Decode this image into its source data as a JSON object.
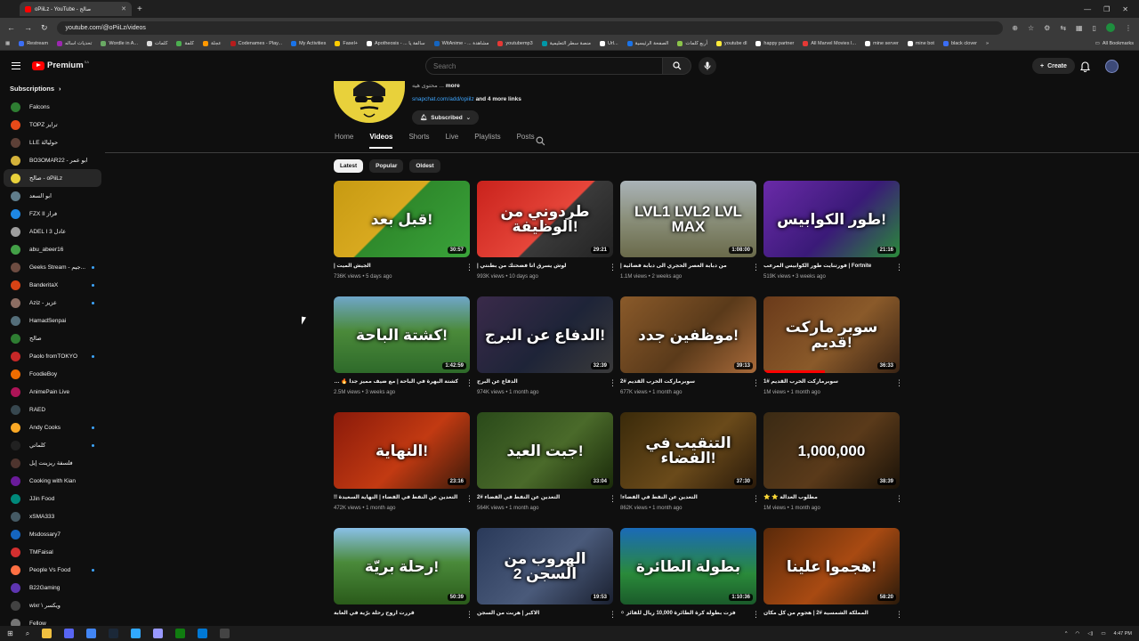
{
  "browser": {
    "tab_title": "oPiiLz - YouTube - صالح",
    "url": "youtube.com/@oPiiLz/videos",
    "bookmarks": [
      {
        "label": "Restream",
        "color": "#3b6ef5"
      },
      {
        "label": "تحديات اساله",
        "color": "#9c27b0"
      },
      {
        "label": "Wordle in A...",
        "color": "#6aaa64"
      },
      {
        "label": "كلمات",
        "color": "#dddddd"
      },
      {
        "label": "كلمة",
        "color": "#4caf50"
      },
      {
        "label": "عجلة",
        "color": "#ff9800"
      },
      {
        "label": "Codenames - Play...",
        "color": "#b71c1c"
      },
      {
        "label": "My Activities",
        "color": "#1a73e8"
      },
      {
        "label": "Fasel+",
        "color": "#ffcc00"
      },
      {
        "label": "Apotheosis - ... سالفة يا",
        "color": "#ffffff"
      },
      {
        "label": "WitAnime - ... مشاهدة",
        "color": "#1565c0"
      },
      {
        "label": "youtubemp3",
        "color": "#e53935"
      },
      {
        "label": "منصة سطر التعليمية",
        "color": "#0097a7"
      },
      {
        "label": "Url...",
        "color": "#ffffff"
      },
      {
        "label": "الصفحة الرئيسية",
        "color": "#1a73e8"
      },
      {
        "label": "أربع كلمات",
        "color": "#8bc34a"
      },
      {
        "label": "youtube dl",
        "color": "#ffeb3b"
      },
      {
        "label": "happy partner",
        "color": "#ffffff"
      },
      {
        "label": "All Marvel Movies I...",
        "color": "#e53935"
      },
      {
        "label": "mine server",
        "color": "#ffffff"
      },
      {
        "label": "mine bot",
        "color": "#ffffff"
      },
      {
        "label": "black clover",
        "color": "#3b6ef5"
      }
    ],
    "all_bookmarks": "All Bookmarks"
  },
  "header": {
    "brand": "Premium",
    "brand_badge": "SA",
    "search_placeholder": "Search",
    "create_label": "Create"
  },
  "sidebar": {
    "title": "Subscriptions",
    "items": [
      {
        "name": "Falcons",
        "color": "#2e7d32",
        "dot": false,
        "active": false
      },
      {
        "name": "TOPZ ترايز",
        "color": "#e64a19",
        "dot": false,
        "active": false
      },
      {
        "name": "LLE حوليالة",
        "color": "#5d4037",
        "dot": false,
        "active": false
      },
      {
        "name": "BO3OMAR22 - ابو عمر",
        "color": "#d4b23a",
        "dot": false,
        "active": false
      },
      {
        "name": "صالح - oPiiLz",
        "color": "#e8d13b",
        "dot": false,
        "active": true
      },
      {
        "name": "ابو السعد",
        "color": "#607d8b",
        "dot": false,
        "active": false
      },
      {
        "name": "FZX II فراز",
        "color": "#1e88e5",
        "dot": false,
        "active": false
      },
      {
        "name": "ADEL I عادل 3",
        "color": "#9e9e9e",
        "dot": false,
        "active": false
      },
      {
        "name": "abu_abeer16",
        "color": "#43a047",
        "dot": false,
        "active": false
      },
      {
        "name": "Geeks Stream - جيم...",
        "color": "#6d4c41",
        "dot": true,
        "active": false
      },
      {
        "name": "BanderitaX",
        "color": "#d84315",
        "dot": true,
        "active": false
      },
      {
        "name": "Aziz - عزيز",
        "color": "#8d6e63",
        "dot": true,
        "active": false
      },
      {
        "name": "HamadSenpai",
        "color": "#546e7a",
        "dot": false,
        "active": false
      },
      {
        "name": "صالح",
        "color": "#2e7d32",
        "dot": false,
        "active": false
      },
      {
        "name": "Paolo fromTOKYO",
        "color": "#c62828",
        "dot": true,
        "active": false
      },
      {
        "name": "FoodieBoy",
        "color": "#ef6c00",
        "dot": false,
        "active": false
      },
      {
        "name": "AnimePain Live",
        "color": "#ad1457",
        "dot": false,
        "active": false
      },
      {
        "name": "RAED",
        "color": "#37474f",
        "dot": false,
        "active": false
      },
      {
        "name": "Andy Cooks",
        "color": "#f9a825",
        "dot": true,
        "active": false
      },
      {
        "name": "كلماتي",
        "color": "#212121",
        "dot": true,
        "active": false
      },
      {
        "name": "فلسفة ريزينت إيل",
        "color": "#4e342e",
        "dot": false,
        "active": false
      },
      {
        "name": "Cooking with Kian",
        "color": "#6a1b9a",
        "dot": false,
        "active": false
      },
      {
        "name": "JJin Food",
        "color": "#00897b",
        "dot": false,
        "active": false
      },
      {
        "name": "xSMA333",
        "color": "#455a64",
        "dot": false,
        "active": false
      },
      {
        "name": "Msdossary7",
        "color": "#1565c0",
        "dot": false,
        "active": false
      },
      {
        "name": "TMFaisal",
        "color": "#d32f2f",
        "dot": false,
        "active": false
      },
      {
        "name": "People Vs Food",
        "color": "#ff7043",
        "dot": true,
        "active": false
      },
      {
        "name": "B22Gaming",
        "color": "#5e35b1",
        "dot": false,
        "active": false
      },
      {
        "name": "wixr \\ ويكسر",
        "color": "#424242",
        "dot": false,
        "active": false
      },
      {
        "name": "Fellow",
        "color": "#757575",
        "dot": false,
        "active": false
      }
    ]
  },
  "channel": {
    "description_prefix": "محتوى هيه ...",
    "more": "more",
    "link": "snapchat.com/add/opiilz",
    "more_links": "and 4 more links",
    "subscribed_label": "Subscribed",
    "tabs": [
      "Home",
      "Videos",
      "Shorts",
      "Live",
      "Playlists",
      "Posts"
    ],
    "active_tab": "Videos",
    "chips": [
      "Latest",
      "Popular",
      "Oldest"
    ],
    "active_chip": "Latest"
  },
  "videos": [
    {
      "title": "الجيش الميت |",
      "meta": "736K views • 5 days ago",
      "duration": "30:57",
      "overlay": "قبل بعد!",
      "bg": "linear-gradient(135deg,#c79a12,#d8a91f 45%,#2f8a2c 46%,#3aa33a)",
      "progress": 0
    },
    {
      "title": "لوش يسرق انا فضحتك من بطنتي |",
      "meta": "993K views • 10 days ago",
      "duration": "29:21",
      "overlay": "طردوني من الوظيفة!",
      "bg": "linear-gradient(135deg,#c9221c,#e6463a 55%,#3a3a3a 56%,#222)",
      "progress": 0
    },
    {
      "title": "من دبابة العصر الحجري الى دبابة فضائية |",
      "meta": "1.1M views • 2 weeks ago",
      "duration": "1:08:00",
      "overlay": "LVL1 LVL2 LVL MAX",
      "bg": "linear-gradient(180deg,#aab3b8,#8a8f7a 50%,#6a6a4a)",
      "progress": 0
    },
    {
      "title": "Fortnite | فورتنايت طور الكوابيس المرعب",
      "meta": "519K views • 3 weeks ago",
      "duration": "21:16",
      "overlay": "طور الكوابيس!",
      "bg": "linear-gradient(135deg,#6a2aa8,#3a1a78 55%,#2a8a3a)",
      "progress": 0
    },
    {
      "title": "كشتة البهرة في الباحة | مع ضيف مميز جداً 🔥 ⛺ 😍",
      "meta": "2.5M views • 3 weeks ago",
      "duration": "1:42:59",
      "overlay": "كشتة الباحة!",
      "bg": "linear-gradient(180deg,#6fa6c9,#4b8a3a 45%,#2e6a2a)",
      "progress": 0
    },
    {
      "title": "الدفاع عن البرج",
      "meta": "974K views • 1 month ago",
      "duration": "32:39",
      "overlay": "الدفاع عن البرج!",
      "bg": "linear-gradient(135deg,#3a2a4a,#1e2438 55%,#3a3a3a)",
      "progress": 0
    },
    {
      "title": "سوبرماركت الخرب القديم #2",
      "meta": "677K views • 1 month ago",
      "duration": "39:13",
      "overlay": "موظفين جدد!",
      "bg": "linear-gradient(135deg,#8a5a2a,#5a3a1a 55%,#a86a3a)",
      "progress": 0
    },
    {
      "title": "سوبرماركت الخرب القديم #1",
      "meta": "1M views • 1 month ago",
      "duration": "36:33",
      "overlay": "سوبر ماركت قديم!",
      "bg": "linear-gradient(135deg,#6a3a1a,#8a5a2a 55%,#3a2414)",
      "progress": 0.45
    },
    {
      "title": "التعدين عن النفط في الفضاء | النهاية السعيدة !!",
      "meta": "472K views • 1 month ago",
      "duration": "23:16",
      "overlay": "النهاية!",
      "bg": "linear-gradient(135deg,#8a1a0a,#c23a12 55%,#3a1a0a)",
      "progress": 0
    },
    {
      "title": "التعدين عن النفط في الفضاء #2",
      "meta": "564K views • 1 month ago",
      "duration": "33:04",
      "overlay": "جبت العيد!",
      "bg": "linear-gradient(135deg,#2a4a1a,#4a6a2a 55%,#1a2a0a)",
      "progress": 0
    },
    {
      "title": "التعدين عن النفط في الفضاء!",
      "meta": "862K views • 1 month ago",
      "duration": "37:30",
      "overlay": "التنقيب في الفضاء!",
      "bg": "linear-gradient(135deg,#3a2a0a,#6a4a1a 55%,#2a1a0a)",
      "progress": 0
    },
    {
      "title": "مطلوب العدالة ⭐ ⭐",
      "meta": "1M views • 1 month ago",
      "duration": "38:39",
      "overlay": "1,000,000",
      "bg": "linear-gradient(135deg,#3a2a14,#5a3a1a 55%,#1a1208)",
      "progress": 0
    },
    {
      "title": "قررت اروح رحلة برّية في الغابة",
      "meta": "",
      "duration": "50:39",
      "overlay": "رحلة بريّة!",
      "bg": "linear-gradient(180deg,#8ac0e8,#4a8a3a 45%,#2a5a1a)",
      "progress": 0
    },
    {
      "title": "الاكبر | هربت من السجن",
      "meta": "",
      "duration": "19:53",
      "overlay": "الهروب من السجن 2",
      "bg": "linear-gradient(135deg,#2a3a5a,#4a5a7a 55%,#1a2030)",
      "progress": 0
    },
    {
      "title": "فزت بطولة كرة الطائرة 10,000 ريال للفائز ⚪",
      "meta": "",
      "duration": "1:10:36",
      "overlay": "بطولة الطائرة",
      "bg": "linear-gradient(180deg,#1a6ab8,#2a8a3a 60%,#1a5a2a)",
      "progress": 0
    },
    {
      "title": "المملكة الشمسية #2 | هجوم من كل مكان",
      "meta": "",
      "duration": "58:20",
      "overlay": "هجموا علينا!",
      "bg": "linear-gradient(135deg,#5a2a0a,#a84a12 55%,#2a1a0a)",
      "progress": 0
    }
  ],
  "taskbar": {
    "time": "4:47 PM",
    "apps": [
      {
        "name": "file-explorer",
        "color": "#f0c040"
      },
      {
        "name": "discord",
        "color": "#5865f2"
      },
      {
        "name": "chrome",
        "color": "#4285f4"
      },
      {
        "name": "steam",
        "color": "#1b2838"
      },
      {
        "name": "photoshop",
        "color": "#31a8ff"
      },
      {
        "name": "premiere",
        "color": "#9999ff"
      },
      {
        "name": "xbox",
        "color": "#107c10"
      },
      {
        "name": "calculator",
        "color": "#0078d4"
      },
      {
        "name": "obs",
        "color": "#444444"
      }
    ]
  }
}
